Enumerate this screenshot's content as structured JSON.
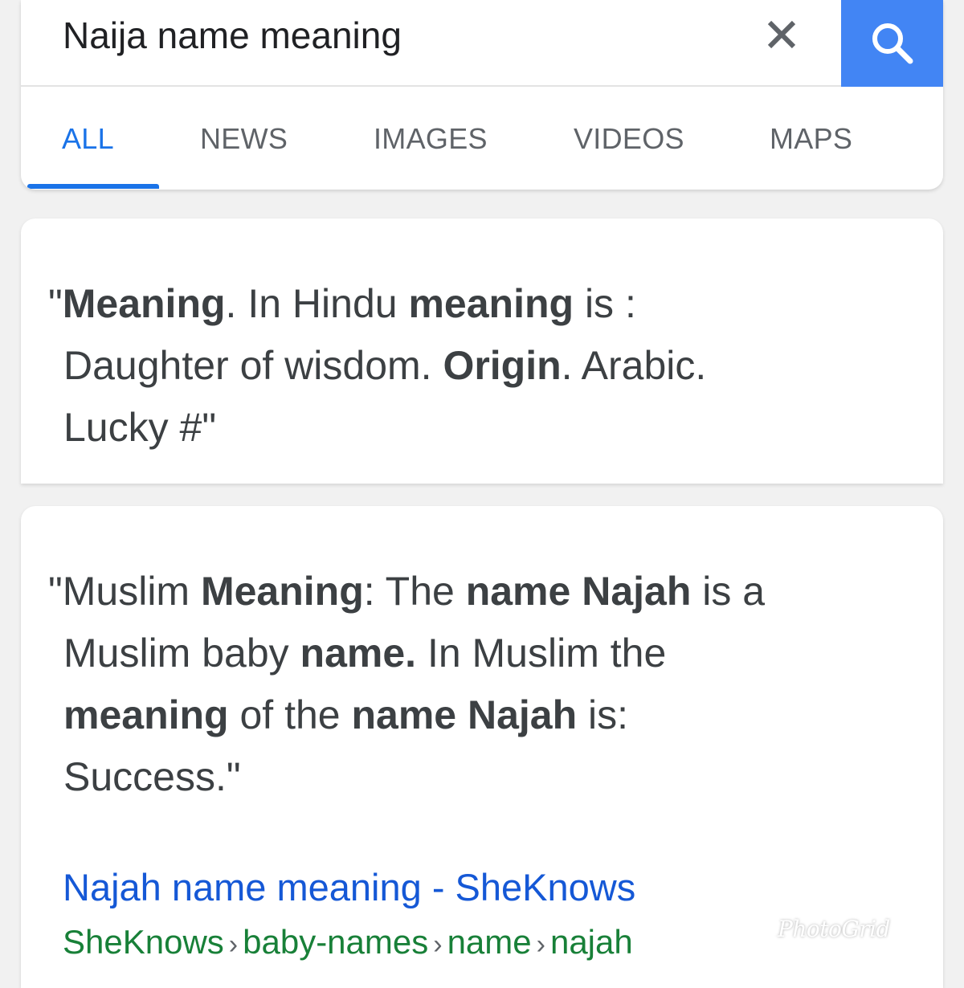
{
  "search": {
    "query": "Naija name meaning",
    "clear_icon": "close-icon",
    "search_icon": "search-icon",
    "accent_color": "#4285f4"
  },
  "tabs": [
    {
      "label": "ALL",
      "active": true
    },
    {
      "label": "NEWS",
      "active": false
    },
    {
      "label": "IMAGES",
      "active": false
    },
    {
      "label": "VIDEOS",
      "active": false
    },
    {
      "label": "MAPS",
      "active": false
    }
  ],
  "result1": {
    "snippet": {
      "open_quote": "\"",
      "w1": "Meaning",
      "t1": ". In Hindu ",
      "w2": "meaning",
      "t2": " is :",
      "t3": "Daughter of wisdom. ",
      "w3": "Origin",
      "t4": ". Arabic.",
      "t5": "Lucky #\""
    }
  },
  "result2": {
    "snippet": {
      "t1": "\"Muslim ",
      "w1": "Meaning",
      "t2": ": The ",
      "w2": "name Najah",
      "t3": " is a",
      "t4": "Muslim baby ",
      "w3": "name.",
      "t5": " In Muslim the",
      "w4": "meaning",
      "t6": " of the ",
      "w5": "name Najah",
      "t7": " is:",
      "t8": "Success.\""
    },
    "link_title": "Najah name meaning - SheKnows",
    "breadcrumb": [
      "SheKnows",
      "baby-names",
      "name",
      "najah"
    ],
    "breadcrumb_separator": "›",
    "link_color": "#1558d6",
    "breadcrumb_color": "#188038"
  },
  "watermark": "PhotoGrid"
}
